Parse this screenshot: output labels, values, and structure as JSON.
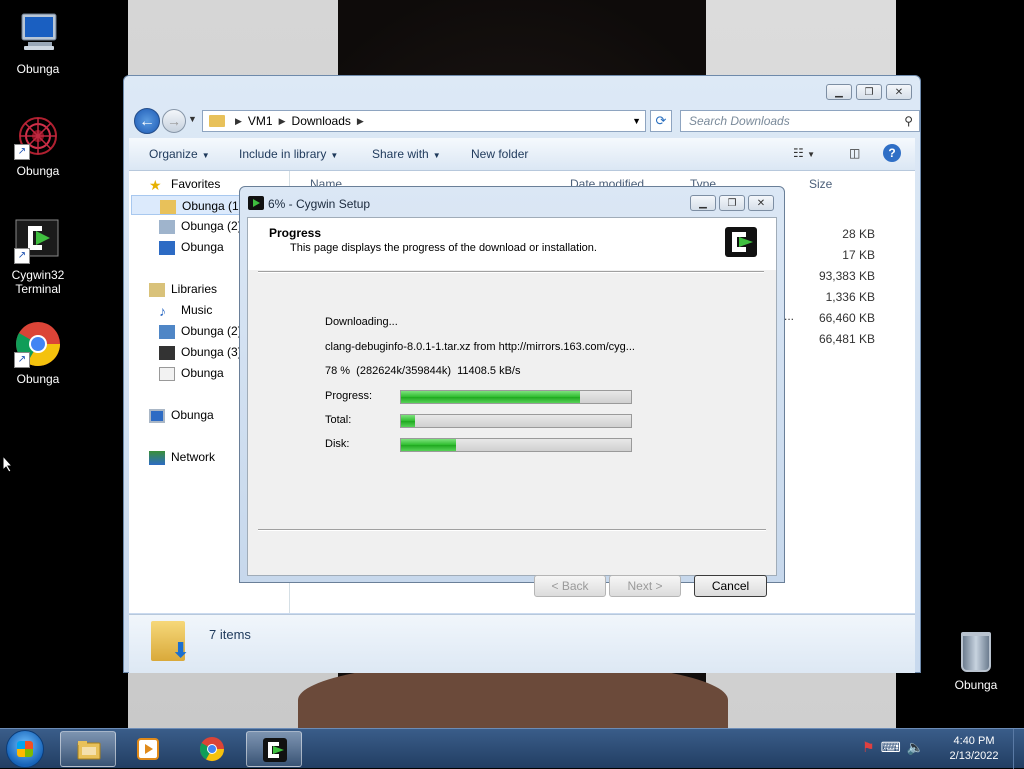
{
  "desktop": {
    "icons": [
      {
        "label": "Obunga",
        "icon": "computer-icon"
      },
      {
        "label": "Obunga",
        "icon": "spiral-app-icon"
      },
      {
        "label": "Cygwin32 Terminal",
        "icon": "cygwin-terminal-icon"
      },
      {
        "label": "Obunga",
        "icon": "chrome-icon"
      }
    ],
    "recycle_bin": {
      "label": "Obunga",
      "icon": "recycle-bin-icon"
    }
  },
  "explorer": {
    "breadcrumb": [
      "VM1",
      "Downloads"
    ],
    "search_placeholder": "Search Downloads",
    "toolbar": {
      "organize": "Organize",
      "include_in_library": "Include in library",
      "share_with": "Share with",
      "new_folder": "New folder"
    },
    "columns": {
      "name": "Name",
      "date_modified": "Date modified",
      "type": "Type",
      "size": "Size"
    },
    "sizes": [
      "28 KB",
      "17 KB",
      "93,383 KB",
      "1,336 KB",
      "66,460 KB",
      "66,481 KB"
    ],
    "truncated_marker": "...",
    "nav": {
      "favorites": "Favorites",
      "favorites_items": [
        "Obunga (1)",
        "Obunga (2)",
        "Obunga"
      ],
      "libraries": "Libraries",
      "libraries_items": [
        "Music",
        "Obunga (2)",
        "Obunga (3)",
        "Obunga"
      ],
      "computer": "Obunga",
      "network": "Network"
    },
    "details": {
      "item_count": "7 items"
    }
  },
  "cygwin": {
    "title": "6% - Cygwin Setup",
    "header_title": "Progress",
    "header_subtitle": "This page displays the progress of the download or installation.",
    "status": "Downloading...",
    "file_line": "clang-debuginfo-8.0.1-1.tar.xz from http://mirrors.163.com/cyg...",
    "stats_line": "78 %  (282624k/359844k)  11408.5 kB/s",
    "bars": [
      {
        "label": "Progress:",
        "value": 0.78
      },
      {
        "label": "Total:",
        "value": 0.06
      },
      {
        "label": "Disk:",
        "value": 0.24
      }
    ],
    "buttons": {
      "back": "< Back",
      "next": "Next >",
      "cancel": "Cancel"
    }
  },
  "taskbar": {
    "clock_time": "4:40 PM",
    "clock_date": "2/13/2022"
  }
}
